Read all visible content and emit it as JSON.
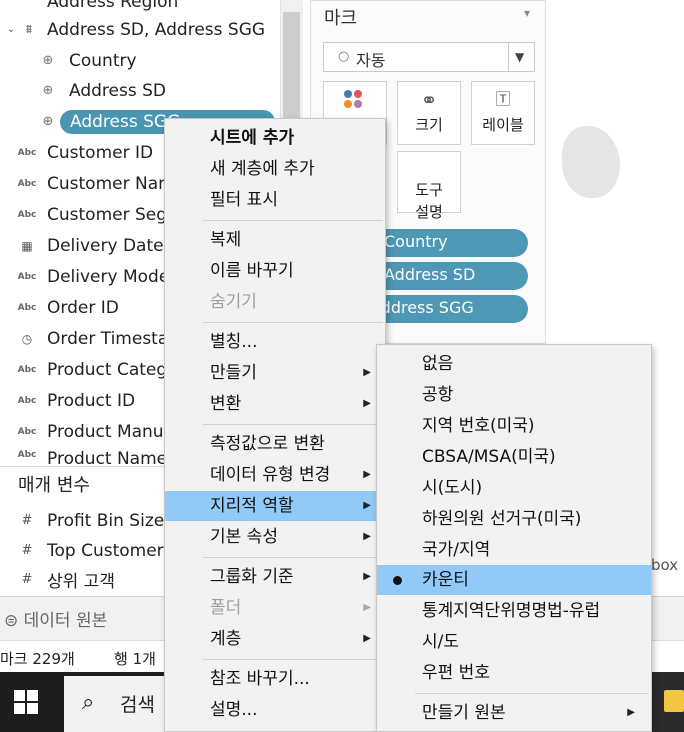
{
  "data_pane": {
    "fields": [
      {
        "name": "Address Region",
        "icon": "hierarchy-field-icon"
      },
      {
        "name": "Address SD, Address SGG",
        "icon": "hierarchy-icon"
      },
      {
        "name": "Country",
        "icon": "globe-icon"
      },
      {
        "name": "Address SD",
        "icon": "globe-icon"
      },
      {
        "name": "Address SGG",
        "icon": "globe-icon"
      },
      {
        "name": "Customer ID",
        "icon": "abc-icon"
      },
      {
        "name": "Customer Nam",
        "icon": "abc-icon"
      },
      {
        "name": "Customer Segm",
        "icon": "abc-icon"
      },
      {
        "name": "Delivery Date",
        "icon": "calendar-icon"
      },
      {
        "name": "Delivery Mode",
        "icon": "abc-icon"
      },
      {
        "name": "Order ID",
        "icon": "abc-icon"
      },
      {
        "name": "Order Timesta",
        "icon": "datetime-icon"
      },
      {
        "name": "Product Categ",
        "icon": "abc-icon"
      },
      {
        "name": "Product ID",
        "icon": "abc-icon"
      },
      {
        "name": "Product Manu",
        "icon": "abc-icon"
      },
      {
        "name": "Product Name",
        "icon": "abc-icon"
      }
    ],
    "params_header": "매개 변수",
    "params": [
      {
        "name": "Profit Bin Size",
        "icon": "number-icon"
      },
      {
        "name": "Top Customer",
        "icon": "number-icon"
      },
      {
        "name": "상위 고객",
        "icon": "number-icon"
      }
    ],
    "abc_glyph": "Abc",
    "number_glyph": "#"
  },
  "datasource_tab": "데이터 원본",
  "status": {
    "marks": "마크 229개",
    "rows": "행 1개"
  },
  "taskbar": {
    "search_label": "검색"
  },
  "marks_card": {
    "title": "마크",
    "mark_type": "자동",
    "buttons": [
      {
        "label": "",
        "icon": "color-icon"
      },
      {
        "label": "크기",
        "icon": "size-icon"
      },
      {
        "label": "레이블",
        "icon": "label-icon"
      },
      {
        "label": "도구\n설명",
        "icon": "tooltip-icon"
      }
    ],
    "pills": [
      "Country",
      "Address SD",
      "Address SGG"
    ]
  },
  "right_label": "box",
  "context_menu": {
    "items": [
      {
        "label": "시트에 추가",
        "bold": true
      },
      {
        "label": "새 계층에 추가"
      },
      {
        "label": "필터 표시"
      },
      {
        "label": "복제"
      },
      {
        "label": "이름 바꾸기"
      },
      {
        "label": "숨기기",
        "disabled": true
      },
      {
        "label": "별칭..."
      },
      {
        "label": "만들기",
        "submenu": true
      },
      {
        "label": "변환",
        "submenu": true
      },
      {
        "label": "측정값으로 변환"
      },
      {
        "label": "데이터 유형 변경",
        "submenu": true
      },
      {
        "label": "지리적 역할",
        "submenu": true,
        "highlighted": true
      },
      {
        "label": "기본 속성",
        "submenu": true
      },
      {
        "label": "그룹화 기준",
        "submenu": true
      },
      {
        "label": "폴더",
        "submenu": true,
        "disabled": true
      },
      {
        "label": "계층",
        "submenu": true
      },
      {
        "label": "참조 바꾸기..."
      },
      {
        "label": "설명..."
      }
    ]
  },
  "geo_submenu": {
    "items": [
      {
        "label": "없음"
      },
      {
        "label": "공항"
      },
      {
        "label": "지역 번호(미국)"
      },
      {
        "label": "CBSA/MSA(미국)"
      },
      {
        "label": "시(도시)"
      },
      {
        "label": "하원의원 선거구(미국)"
      },
      {
        "label": "국가/지역"
      },
      {
        "label": "카운티",
        "selected": true
      },
      {
        "label": "통계지역단위명명법-유럽"
      },
      {
        "label": "시/도"
      },
      {
        "label": "우편 번호"
      },
      {
        "label": "만들기 원본",
        "submenu": true
      }
    ]
  },
  "colors": {
    "pill": "#4e98b5",
    "highlight": "#91c9f7",
    "menu_bg": "#f2f2f2"
  }
}
